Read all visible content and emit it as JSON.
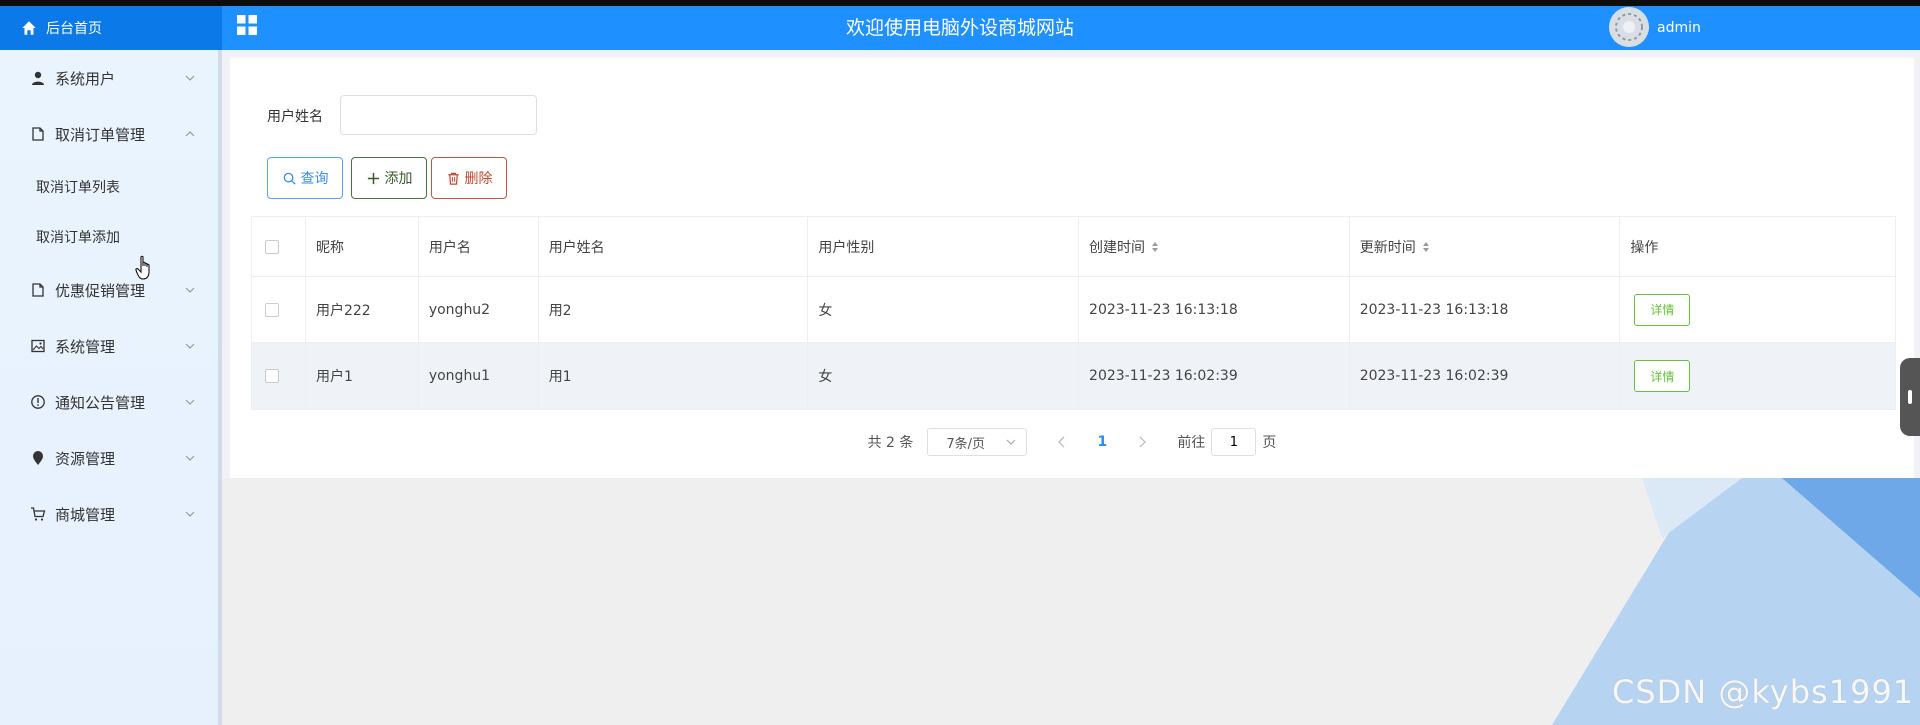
{
  "header": {
    "brand_label": "后台首页",
    "site_title": "欢迎使用电脑外设商城网站",
    "username": "admin"
  },
  "sidebar": {
    "items": [
      {
        "label": "系统用户",
        "icon": "user-icon",
        "expanded": false
      },
      {
        "label": "取消订单管理",
        "icon": "document-icon",
        "expanded": true,
        "children": [
          {
            "label": "取消订单列表"
          },
          {
            "label": "取消订单添加"
          }
        ]
      },
      {
        "label": "优惠促销管理",
        "icon": "document-icon",
        "expanded": false
      },
      {
        "label": "系统管理",
        "icon": "image-icon",
        "expanded": false
      },
      {
        "label": "通知公告管理",
        "icon": "info-circle-icon",
        "expanded": false
      },
      {
        "label": "资源管理",
        "icon": "location-pin-icon",
        "expanded": false
      },
      {
        "label": "商城管理",
        "icon": "cart-icon",
        "expanded": false
      }
    ]
  },
  "search": {
    "label": "用户姓名",
    "value": "",
    "placeholder": ""
  },
  "toolbar": {
    "query_label": "查询",
    "add_label": "添加",
    "delete_label": "删除"
  },
  "table": {
    "columns": [
      "昵称",
      "用户名",
      "用户姓名",
      "用户性别",
      "创建时间",
      "更新时间",
      "操作"
    ],
    "rows": [
      {
        "nickname": "用户222",
        "username": "yonghu2",
        "realname": "用2",
        "gender": "女",
        "created": "2023-11-23 16:13:18",
        "updated": "2023-11-23 16:13:18",
        "action": "详情"
      },
      {
        "nickname": "用户1",
        "username": "yonghu1",
        "realname": "用1",
        "gender": "女",
        "created": "2023-11-23 16:02:39",
        "updated": "2023-11-23 16:02:39",
        "action": "详情"
      }
    ]
  },
  "pagination": {
    "total_text": "共 2 条",
    "page_size": "7条/页",
    "current_page": "1",
    "goto_label": "前往",
    "goto_value": "1",
    "page_suffix": "页"
  },
  "watermark": "CSDN @kybs1991",
  "colors": {
    "header_blue": "#1e90ff",
    "brand_blue": "#0b79e8",
    "sidebar_bg": "#eaf4ff",
    "detail_green": "#67c23a"
  }
}
